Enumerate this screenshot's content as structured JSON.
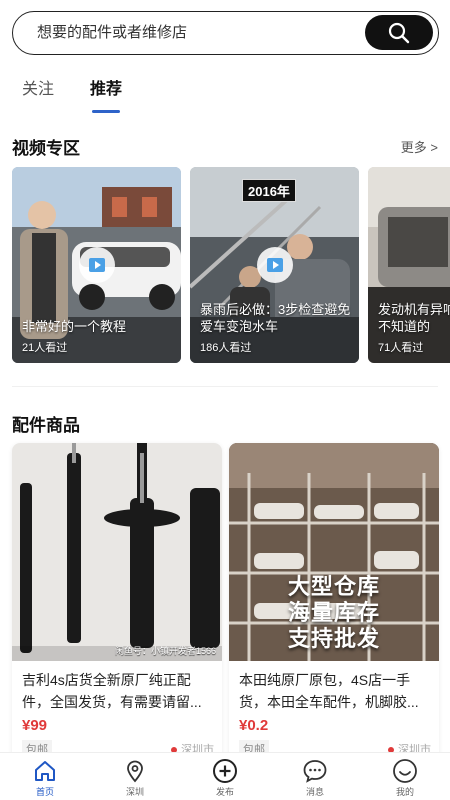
{
  "search": {
    "placeholder": "想要的配件或者维修店"
  },
  "tabs": [
    {
      "label": "关注"
    },
    {
      "label": "推荐"
    }
  ],
  "video_section": {
    "title": "视频专区",
    "more": "更多 >",
    "videos": [
      {
        "title": "非常好的一个教程",
        "views": "21人看过"
      },
      {
        "title": "暴雨后必做：3步检查避免爱车变泡水车",
        "views": "186人看过",
        "badge": "2016年"
      },
      {
        "title": "发动机有异响车主不知道的",
        "views": "71人看过"
      }
    ]
  },
  "product_section": {
    "title": "配件商品",
    "products": [
      {
        "title": "吉利4s店货全新原厂纯正配件，全国发货，有需要请留...",
        "price": "¥99",
        "tag": "包邮",
        "location": "深圳市",
        "image_caption": "闲鱼号：小镇开发者1566"
      },
      {
        "title": "本田纯原厂原包，4S店一手货，本田全车配件，机脚胶...",
        "price": "¥0.2",
        "tag": "包邮",
        "location": "深圳市",
        "image_text": [
          "大型仓库",
          "海量库存",
          "支持批发"
        ]
      }
    ]
  },
  "bottom_nav": [
    {
      "label": "首页",
      "icon": "home-icon",
      "active": true
    },
    {
      "label": "深圳",
      "icon": "location-icon"
    },
    {
      "label": "发布",
      "icon": "plus-circle-icon"
    },
    {
      "label": "消息",
      "icon": "message-icon"
    },
    {
      "label": "我的",
      "icon": "profile-icon"
    }
  ],
  "colors": {
    "accent": "#2e63c9",
    "price": "#e03a3a",
    "nav_active": "#1f57c4"
  }
}
